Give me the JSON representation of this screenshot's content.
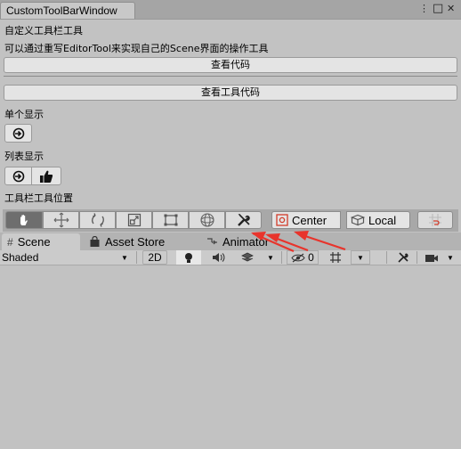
{
  "window": {
    "tab_title": "CustomToolBarWindow",
    "kebab_glyph": "⋮",
    "maximize_glyph": "□",
    "close_glyph": "✕"
  },
  "content": {
    "heading": "自定义工具栏工具",
    "description": "可以通过重写EditorTool来实现自己的Scene界面的操作工具",
    "view_code_button": "查看代码",
    "view_tool_code_button": "查看工具代码",
    "single_display_label": "单个显示",
    "list_display_label": "列表显示",
    "toolbar_position_label": "工具栏工具位置"
  },
  "unity_toolbar": {
    "pivot_mode": "Center",
    "pivot_rotation": "Local"
  },
  "scene_tabs": {
    "scene": "Scene",
    "asset_store": "Asset Store",
    "animator": "Animator"
  },
  "scene_bar": {
    "shading_mode": "Shaded",
    "mode_2d": "2D",
    "hidden_count": "0"
  },
  "colors": {
    "background": "#c2c2c2",
    "button": "#e4e4e4",
    "arrow": "#e8342c",
    "active_tool": "#6e6e6e"
  }
}
